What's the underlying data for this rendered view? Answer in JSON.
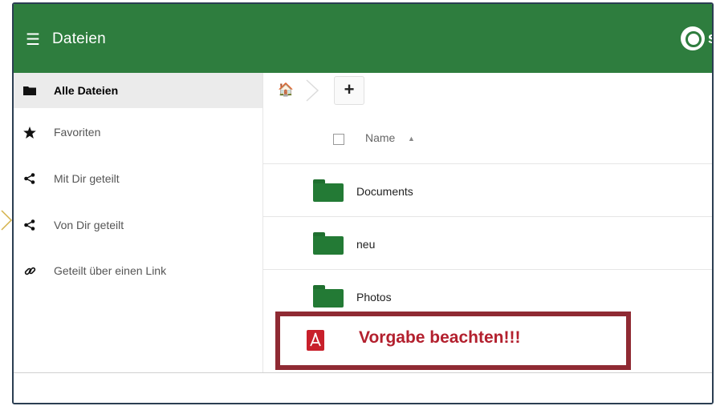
{
  "header": {
    "menu_icon": "menu-icon",
    "title": "Dateien",
    "logo_text": "s",
    "color": "#2e7d3e"
  },
  "sidebar": {
    "items": [
      {
        "label": "Alle Dateien",
        "icon": "folder-icon",
        "active": true
      },
      {
        "label": "Favoriten",
        "icon": "star-icon",
        "active": false
      },
      {
        "label": "Mit Dir geteilt",
        "icon": "share-icon",
        "active": false
      },
      {
        "label": "Von Dir geteilt",
        "icon": "share-icon",
        "active": false
      },
      {
        "label": "Geteilt über einen Link",
        "icon": "link-icon",
        "active": false
      }
    ]
  },
  "toolbar": {
    "home_icon": "home-icon",
    "add_label": "+"
  },
  "list": {
    "column_name": "Name",
    "sort_indicator": "▲",
    "rows": [
      {
        "name": "Documents",
        "type": "folder"
      },
      {
        "name": "neu",
        "type": "folder"
      },
      {
        "name": "Photos",
        "type": "folder"
      }
    ]
  },
  "highlight": {
    "text": "Vorgabe beachten!!!",
    "icon": "pdf-icon",
    "border_color": "#8f2a33",
    "text_color": "#b3202e"
  }
}
